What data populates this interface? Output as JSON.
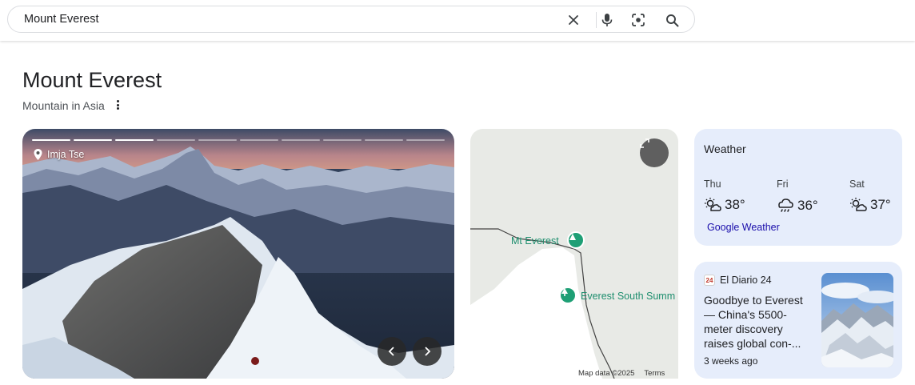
{
  "search": {
    "query": "Mount Everest"
  },
  "entity": {
    "title": "Mount Everest",
    "subtitle": "Mountain in Asia"
  },
  "photo": {
    "location": "Imja Tse",
    "slides_total": 10,
    "slides_viewed": 3
  },
  "map": {
    "label_1": "Mt Everest",
    "label_2": "Everest South Summ",
    "data_text": "Map data ©2025",
    "terms": "Terms"
  },
  "weather": {
    "title": "Weather",
    "days": [
      {
        "name": "Thu",
        "temp": "38°",
        "icon": "partly-sunny-icon"
      },
      {
        "name": "Fri",
        "temp": "36°",
        "icon": "rain-cloud-icon"
      },
      {
        "name": "Sat",
        "temp": "37°",
        "icon": "partly-sunny-icon"
      }
    ],
    "link": "Google Weather"
  },
  "news": {
    "source": "El Diario 24",
    "source_badge": "24",
    "headline": "Goodbye to Everest — China's 5500-meter discovery raises global con-...",
    "time": "3 weeks ago"
  },
  "colors": {
    "card_bg": "#e6edfb",
    "link": "#1a0dab",
    "map_green": "#1e9f75"
  }
}
